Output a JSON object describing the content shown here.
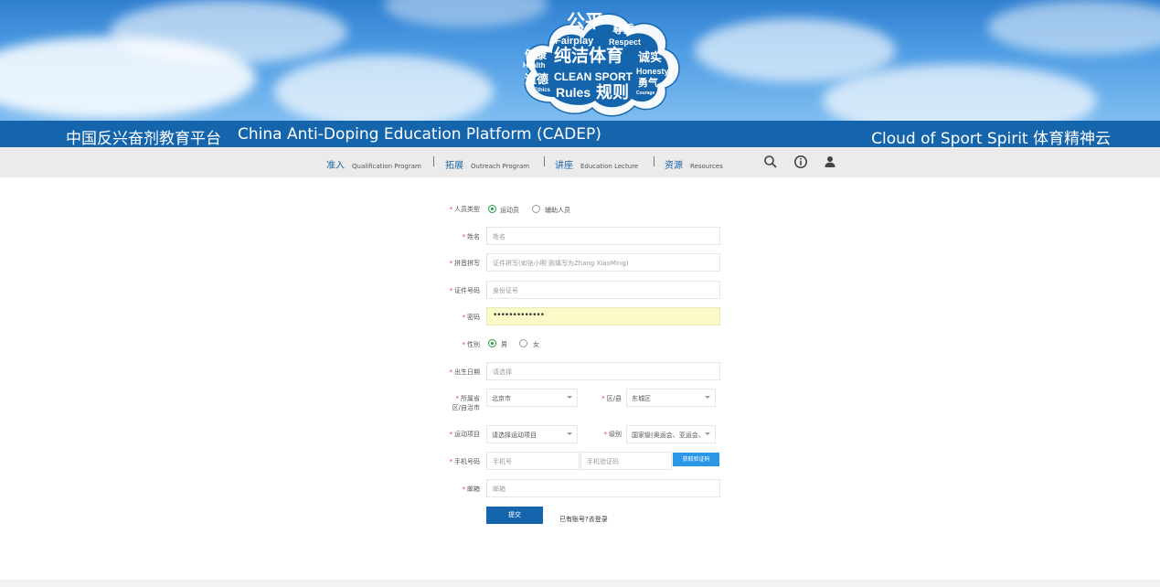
{
  "banner": {
    "logo": {
      "word_gongping": "公平",
      "word_zunzhong": "尊重",
      "word_fairplay": "Fairplay",
      "word_respect": "Respect",
      "word_jiankang": "健康",
      "word_health": "Health",
      "word_chunjie": "纯洁体育",
      "word_chengshi": "诚实",
      "word_honesty": "Honesty",
      "word_daode": "道德",
      "word_ethics": "Ethics",
      "word_clean": "CLEAN SPORT",
      "word_yongqi": "勇气",
      "word_courage": "Courage",
      "word_rules": "Rules",
      "word_guize": "规则"
    }
  },
  "titlebar": {
    "cn": "中国反兴奋剂教育平台",
    "en": "China Anti-Doping Education Platform (CADEP)",
    "right": "Cloud of Sport Spirit  体育精神云"
  },
  "nav": {
    "items": [
      {
        "label": "准入",
        "sub": "Qualification Program"
      },
      {
        "label": "拓展",
        "sub": "Outreach Program"
      },
      {
        "label": "讲座",
        "sub": "Education Lecture"
      },
      {
        "label": "资源",
        "sub": "Resources"
      }
    ]
  },
  "form": {
    "req_mark": "*",
    "person_type": {
      "label": "人员类型",
      "options": [
        "运动员",
        "辅助人员"
      ],
      "selected": 0
    },
    "name": {
      "label": "姓名",
      "placeholder": "姓名"
    },
    "pinyin": {
      "label": "拼音拼写",
      "placeholder": "证件拼写(如张小明 则填写为Zhang XiaoMing)"
    },
    "id_number": {
      "label": "证件号码",
      "placeholder": "身份证号"
    },
    "password": {
      "label": "密码",
      "value": "•••••••••••••"
    },
    "gender": {
      "label": "性别",
      "options": [
        "男",
        "女"
      ],
      "selected": 0
    },
    "birthdate": {
      "label": "出生日期",
      "placeholder": "请选择"
    },
    "region": {
      "label_line1": "所属省",
      "label_line2": "区/自治市",
      "value": "北京市"
    },
    "district": {
      "label": "区/县",
      "value": "东城区"
    },
    "sport": {
      "label": "运动项目",
      "value": "请选择运动项目"
    },
    "level": {
      "label": "级别",
      "value": "国家级(奥运会、亚运会、明"
    },
    "phone": {
      "label": "手机号码",
      "placeholder": "手机号",
      "code_placeholder": "手机验证码",
      "code_button": "获取验证码"
    },
    "email": {
      "label": "邮箱",
      "placeholder": "邮箱"
    },
    "submit": "提交",
    "login_link": "已有账号?去登录"
  }
}
